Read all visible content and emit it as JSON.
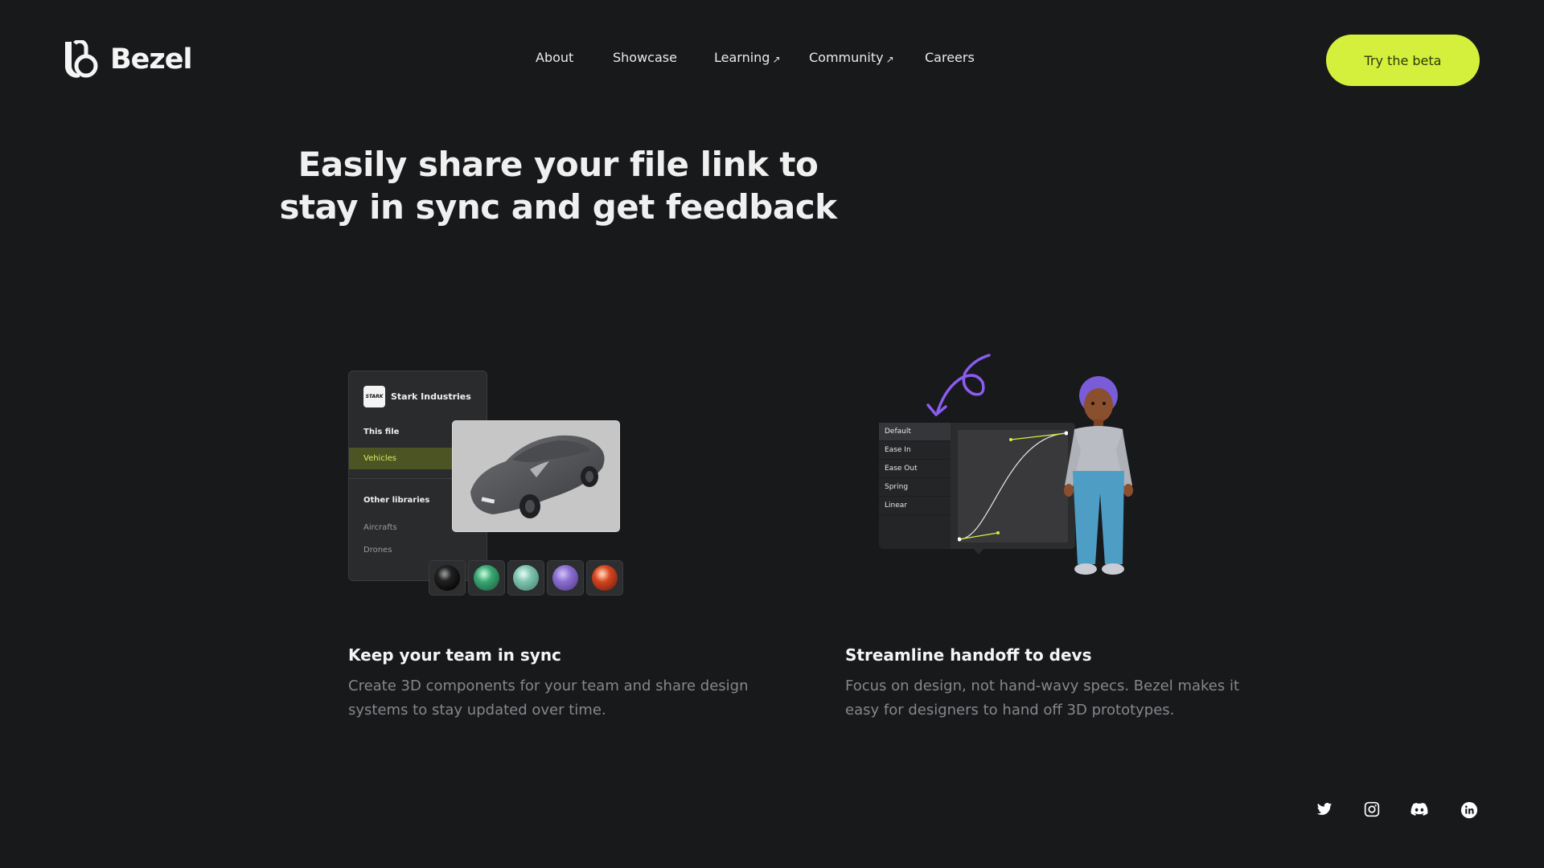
{
  "brand": {
    "name": "Bezel"
  },
  "nav": {
    "items": [
      {
        "label": "About",
        "external": false
      },
      {
        "label": "Showcase",
        "external": false
      },
      {
        "label": "Learning",
        "external": true
      },
      {
        "label": "Community",
        "external": true
      },
      {
        "label": "Careers",
        "external": false
      }
    ],
    "external_glyph": "↗"
  },
  "cta": {
    "label": "Try the beta",
    "color": "#d4f03c"
  },
  "hero": {
    "title_line1": "Easily share your file link to",
    "title_line2": "stay in sync and get feedback"
  },
  "library_panel": {
    "company": "Stark Industries",
    "company_logo_text": "STARK",
    "section_this_file": "This file",
    "active_item": "Vehicles",
    "section_other": "Other libraries",
    "other_items": [
      "Aircrafts",
      "Drones"
    ]
  },
  "materials": [
    "black",
    "green",
    "mint",
    "purple",
    "red"
  ],
  "easing_panel": {
    "options": [
      "Default",
      "Ease In",
      "Ease Out",
      "Spring",
      "Linear"
    ],
    "selected": "Default"
  },
  "features": [
    {
      "title": "Keep your team in sync",
      "desc_line1": "Create 3D components for your team and share design",
      "desc_line2": "systems to stay updated over time."
    },
    {
      "title": "Streamline handoff to devs",
      "desc_line1": "Focus on design, not hand-wavy specs. Bezel makes it",
      "desc_line2": "easy for designers to hand off 3D prototypes."
    }
  ],
  "social": [
    "twitter-icon",
    "instagram-icon",
    "discord-icon",
    "linkedin-icon"
  ],
  "colors": {
    "background": "#18191b",
    "accent": "#d4f03c",
    "muted_text": "#86878b"
  }
}
